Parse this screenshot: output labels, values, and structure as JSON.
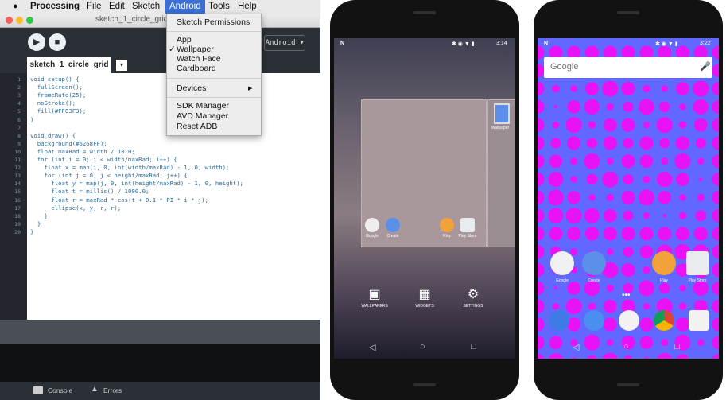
{
  "ide": {
    "menubar": [
      "Processing",
      "File",
      "Edit",
      "Sketch",
      "Android",
      "Tools",
      "Help"
    ],
    "window_title": "sketch_1_circle_grid",
    "mode_button": "Android ▾",
    "tab_label": "sketch_1_circle_grid",
    "tab_menu_arrow": "▾",
    "line_numbers": [
      "1",
      "2",
      "3",
      "4",
      "5",
      "6",
      "7",
      "8",
      "9",
      "10",
      "11",
      "12",
      "13",
      "14",
      "15",
      "16",
      "17",
      "18",
      "19",
      "20"
    ],
    "code_lines": [
      "void setup() {",
      "  fullScreen();",
      "  frameRate(25);",
      "  noStroke();",
      "  fill(#FF03F3);",
      "}",
      "",
      "void draw() {",
      "  background(#6268FF);",
      "  float maxRad = width / 10.0;",
      "  for (int i = 0; i < width/maxRad; i++) {",
      "    float x = map(i, 0, int(width/maxRad) - 1, 0, width);",
      "    for (int j = 0; j < height/maxRad; j++) {",
      "      float y = map(j, 0, int(height/maxRad) - 1, 0, height);",
      "      float t = millis() / 1000.0;",
      "      float r = maxRad * cos(t + 0.1 * PI * i * j);",
      "      ellipse(x, y, r, r);",
      "    }",
      "  }",
      "}"
    ],
    "status": {
      "console": "Console",
      "errors": "Errors"
    },
    "android_menu": {
      "items": [
        "Sketch Permissions",
        "App",
        "Wallpaper",
        "Watch Face",
        "Cardboard",
        "Devices",
        "SDK Manager",
        "AVD Manager",
        "Reset ADB"
      ],
      "checkmark": "✓",
      "submenu_arrow": "▶"
    },
    "colors": {
      "menu_highlight": "#3b6fd6",
      "background_literal": "#6268FF",
      "fill_literal": "#FF03F3"
    }
  },
  "phone1": {
    "status_left": "N",
    "status_time": "3:14",
    "preview_label": "Wallpaper",
    "app_labels": [
      "Google",
      "Create",
      "Play",
      "Play Store"
    ],
    "actions": [
      "WALLPAPERS",
      "WIDGETS",
      "SETTINGS"
    ],
    "nav": [
      "◁",
      "○",
      "□"
    ]
  },
  "phone2": {
    "status_left": "N",
    "status_time": "3:22",
    "search_brand": "Google",
    "app_labels": [
      "Google",
      "Create",
      "Play",
      "Play Store"
    ],
    "nav": [
      "◁",
      "○",
      "□"
    ],
    "colors": {
      "wallpaper_bg": "#6268FF",
      "wallpaper_dots": "#FF03F3"
    }
  }
}
